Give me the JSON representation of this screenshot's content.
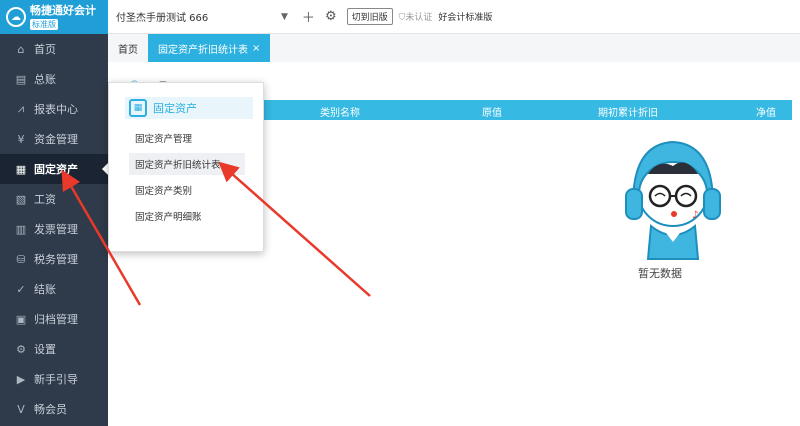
{
  "app": {
    "brand": "畅捷通好会计",
    "edition": "标准版"
  },
  "sidebar": {
    "items": [
      {
        "label": "首页",
        "icon": "home-icon",
        "glyph": "⌂"
      },
      {
        "label": "总账",
        "icon": "ledger-icon",
        "glyph": "▤"
      },
      {
        "label": "报表中心",
        "icon": "report-icon",
        "glyph": "📈"
      },
      {
        "label": "资金管理",
        "icon": "money-icon",
        "glyph": "¥"
      },
      {
        "label": "固定资产",
        "icon": "asset-icon",
        "glyph": "▦"
      },
      {
        "label": "工资",
        "icon": "salary-icon",
        "glyph": "▧"
      },
      {
        "label": "发票管理",
        "icon": "invoice-icon",
        "glyph": "▥"
      },
      {
        "label": "税务管理",
        "icon": "tax-icon",
        "glyph": "⛁"
      },
      {
        "label": "结账",
        "icon": "close-books-icon",
        "glyph": "✓"
      },
      {
        "label": "归档管理",
        "icon": "archive-icon",
        "glyph": "▣"
      },
      {
        "label": "设置",
        "icon": "settings-icon",
        "glyph": "⚙"
      },
      {
        "label": "新手引导",
        "icon": "guide-icon",
        "glyph": "▶"
      },
      {
        "label": "畅会员",
        "icon": "vip-icon",
        "glyph": "V"
      }
    ]
  },
  "topbar": {
    "company": "付圣杰手册测试 666",
    "switch_old": "切到旧版",
    "cert_status": "未认证",
    "plan": "好会计标准版"
  },
  "tabs": [
    {
      "label": "首页"
    },
    {
      "label": "固定资产折旧统计表",
      "close": "×"
    }
  ],
  "subtabs": [
    "",
    ""
  ],
  "table": {
    "headers": [
      "类别名称",
      "原值",
      "期初累计折旧",
      "净值"
    ]
  },
  "empty_text": "暂无数据",
  "menu": {
    "title": "固定资产",
    "items": [
      "固定资产管理",
      "固定资产折旧统计表",
      "固定资产类别",
      "固定资产明细账"
    ]
  },
  "colors": {
    "accent": "#2bb0df",
    "sidebar_bg": "#2f3a4a",
    "arrow": "#e8392b"
  }
}
